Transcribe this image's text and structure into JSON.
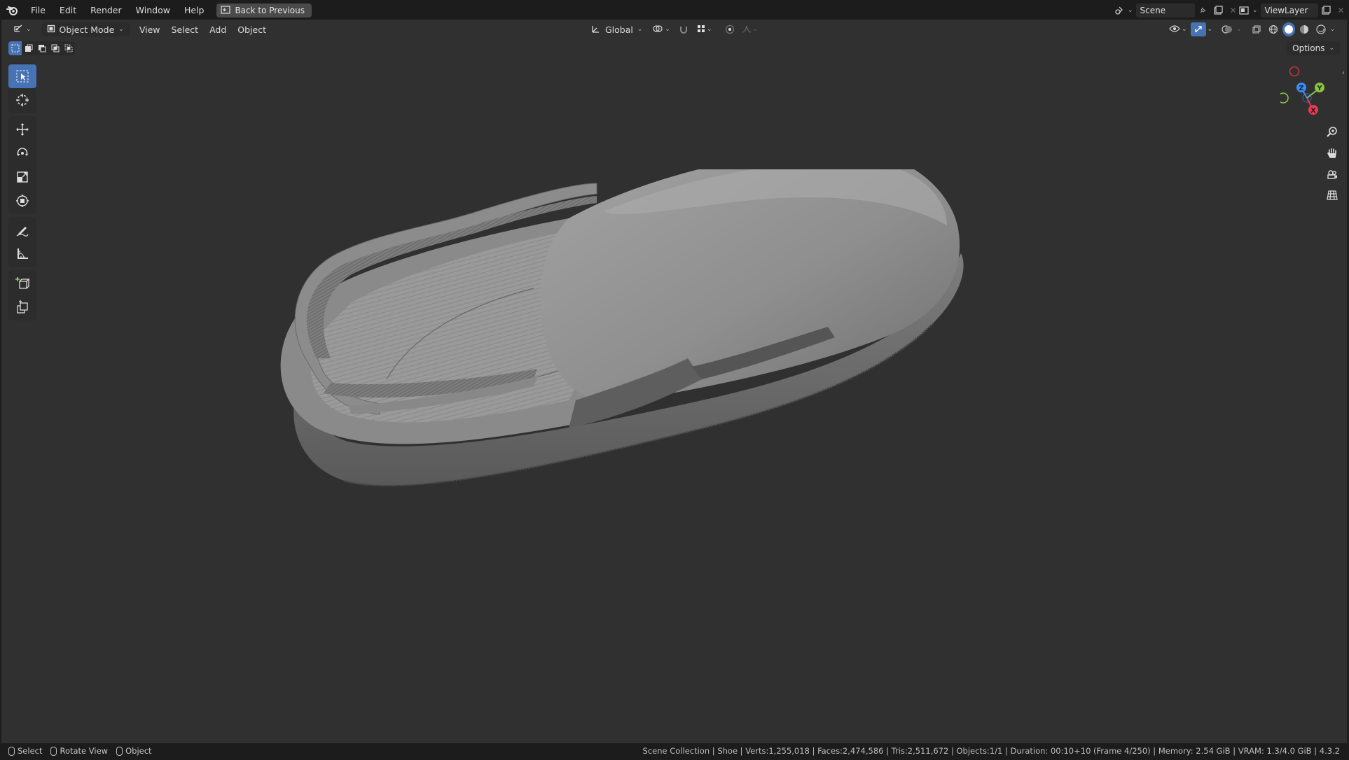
{
  "topbar": {
    "menus": [
      "File",
      "Edit",
      "Render",
      "Window",
      "Help"
    ],
    "back_button": "Back to Previous",
    "scene_name": "Scene",
    "view_layer": "ViewLayer"
  },
  "viewport_header": {
    "mode": "Object Mode",
    "menus": [
      "View",
      "Select",
      "Add",
      "Object"
    ],
    "orientation": "Global",
    "options": "Options"
  },
  "toolbar": {
    "tools": [
      "select-box",
      "cursor",
      "move",
      "rotate",
      "scale",
      "transform",
      "annotate",
      "measure",
      "add-cube",
      "extrude"
    ],
    "active_tool": "select-box"
  },
  "gizmo": {
    "axes": [
      "X",
      "Y",
      "Z"
    ],
    "colors": {
      "x": "#e83a53",
      "y": "#8bc53f",
      "z": "#3b8ff0"
    }
  },
  "statusbar": {
    "hints": [
      "Select",
      "Rotate View",
      "Object"
    ],
    "info": "Scene Collection | Shoe | Verts:1,255,018 | Faces:2,474,586 | Tris:2,511,672 | Objects:1/1 | Duration: 00:10+10 (Frame 4/250) | Memory: 2.54 GiB | VRAM: 1.3/4.0 GiB | 4.3.2"
  },
  "colors": {
    "accent": "#4772b3",
    "viewport_bg": "#303030",
    "header_bg": "#1c1c1c"
  }
}
